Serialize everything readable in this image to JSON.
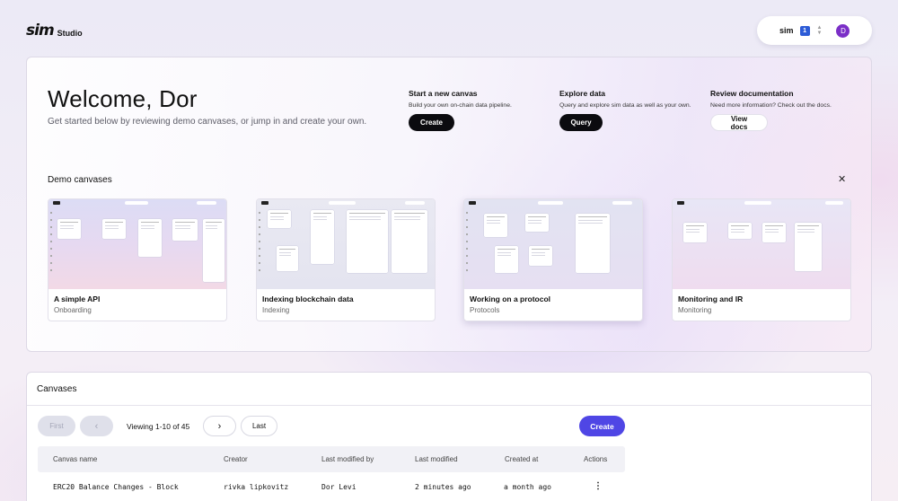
{
  "header": {
    "logo_mark": "sim",
    "logo_text": "Studio",
    "account_name": "sim",
    "account_badge": "1",
    "avatar_initial": "D"
  },
  "welcome": {
    "title": "Welcome, Dor",
    "subtitle": "Get started below by reviewing demo canvases, or jump in and create your own.",
    "actions": [
      {
        "title": "Start a new canvas",
        "desc": "Build your own on-chain data pipeline.",
        "button": "Create"
      },
      {
        "title": "Explore data",
        "desc": "Query and explore sim data as well as your own.",
        "button": "Query"
      },
      {
        "title": "Review documentation",
        "desc": "Need more information? Check out the docs.",
        "button": "View docs"
      }
    ]
  },
  "demo": {
    "heading": "Demo canvases",
    "close_glyph": "✕",
    "cards": [
      {
        "title": "A simple API",
        "tag": "Onboarding"
      },
      {
        "title": "Indexing blockchain data",
        "tag": "Indexing"
      },
      {
        "title": "Working on a protocol",
        "tag": "Protocols"
      },
      {
        "title": "Monitoring and IR",
        "tag": "Monitoring"
      }
    ]
  },
  "canvases": {
    "title": "Canvases",
    "pagination": {
      "first": "First",
      "prev": "‹",
      "viewing": "Viewing 1-10 of 45",
      "next": "›",
      "last": "Last"
    },
    "create_label": "Create",
    "columns": [
      "Canvas name",
      "Creator",
      "Last modified by",
      "Last modified",
      "Created at",
      "Actions"
    ],
    "rows": [
      {
        "name": "ERC20 Balance Changes - Block",
        "creator": "rivka lipkovitz",
        "modified_by": "Dor Levi",
        "modified": "2 minutes ago",
        "created": "a month ago",
        "actions": "⋮"
      }
    ]
  },
  "colors": {
    "accent": "#4f46e5",
    "badge": "#2c5bd6",
    "avatar": "#7b2fc7"
  },
  "icons": {
    "close": "close-icon",
    "chevron_left": "chevron-left-icon",
    "chevron_right": "chevron-right-icon",
    "kebab": "kebab-menu-icon",
    "updown": "chevron-updown-icon"
  }
}
